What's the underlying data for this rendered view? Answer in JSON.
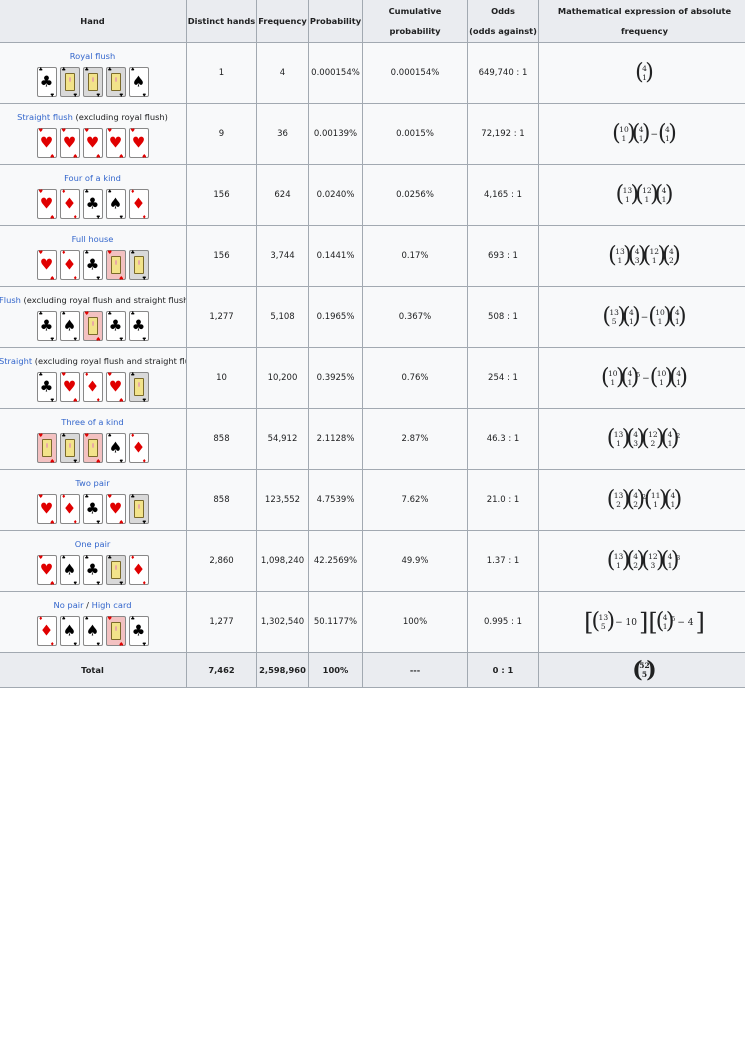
{
  "headers": {
    "hand": "Hand",
    "distinct": "Distinct hands",
    "frequency": "Frequency",
    "probability": "Probability",
    "cumulative": "Cumulative probability",
    "odds_line1": "Odds",
    "odds_line2": "(odds against)",
    "math": "Mathematical expression of absolute frequency"
  },
  "rows": [
    {
      "name": "Royal flush",
      "note": "",
      "distinct": "1",
      "frequency": "4",
      "probability": "0.000154%",
      "cumulative": "0.000154%",
      "odds": "649,740 : 1"
    },
    {
      "name": "Straight flush",
      "note": " (excluding royal flush)",
      "distinct": "9",
      "frequency": "36",
      "probability": "0.00139%",
      "cumulative": "0.0015%",
      "odds": "72,192 : 1"
    },
    {
      "name": "Four of a kind",
      "note": "",
      "distinct": "156",
      "frequency": "624",
      "probability": "0.0240%",
      "cumulative": "0.0256%",
      "odds": "4,165 : 1"
    },
    {
      "name": "Full house",
      "note": "",
      "distinct": "156",
      "frequency": "3,744",
      "probability": "0.1441%",
      "cumulative": "0.17%",
      "odds": "693 : 1"
    },
    {
      "name": "Flush",
      "note": " (excluding royal flush and straight flush)",
      "distinct": "1,277",
      "frequency": "5,108",
      "probability": "0.1965%",
      "cumulative": "0.367%",
      "odds": "508 : 1"
    },
    {
      "name": "Straight",
      "note": " (excluding royal flush and straight flush)",
      "distinct": "10",
      "frequency": "10,200",
      "probability": "0.3925%",
      "cumulative": "0.76%",
      "odds": "254 : 1"
    },
    {
      "name": "Three of a kind",
      "note": "",
      "distinct": "858",
      "frequency": "54,912",
      "probability": "2.1128%",
      "cumulative": "2.87%",
      "odds": "46.3 : 1"
    },
    {
      "name": "Two pair",
      "note": "",
      "distinct": "858",
      "frequency": "123,552",
      "probability": "4.7539%",
      "cumulative": "7.62%",
      "odds": "21.0 : 1"
    },
    {
      "name": "One pair",
      "note": "",
      "distinct": "2,860",
      "frequency": "1,098,240",
      "probability": "42.2569%",
      "cumulative": "49.9%",
      "odds": "1.37 : 1"
    },
    {
      "name": "No pair",
      "note": " / ",
      "name2": "High card",
      "distinct": "1,277",
      "frequency": "1,302,540",
      "probability": "50.1177%",
      "cumulative": "100%",
      "odds": "0.995 : 1"
    }
  ],
  "total": {
    "label": "Total",
    "distinct": "7,462",
    "frequency": "2,598,960",
    "probability": "100%",
    "cumulative": "---",
    "odds": "0 : 1"
  },
  "math": {
    "n4": "4",
    "n1": "1",
    "n10": "10",
    "n13": "13",
    "n12": "12",
    "n3": "3",
    "n2": "2",
    "n5": "5",
    "n11": "11",
    "n52": "52",
    "minus": "−",
    "minus10": "− 10",
    "minus4": "− 4",
    "sup5": "5",
    "sup2": "2",
    "sup3": "3",
    "lb": "[",
    "rb": "]"
  }
}
